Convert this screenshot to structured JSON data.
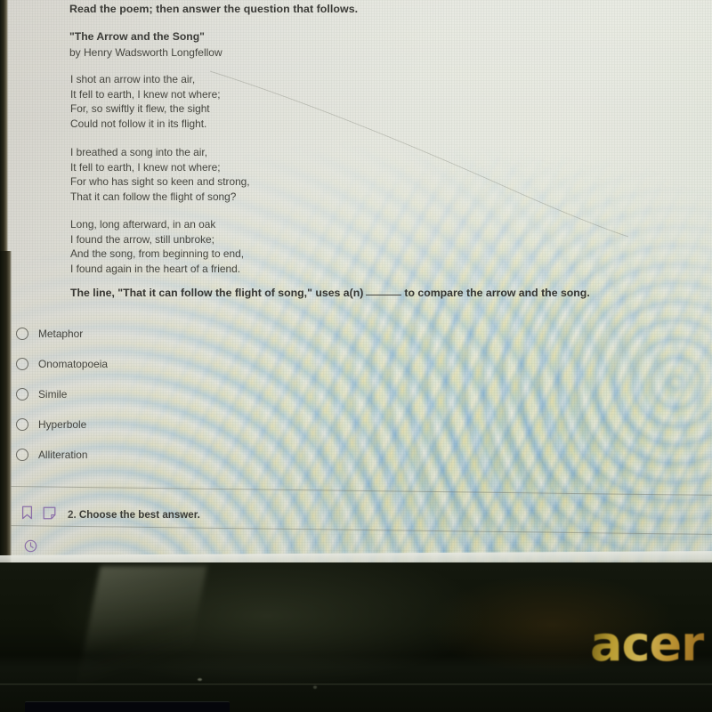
{
  "screen": {
    "prompt": "Read the poem; then answer the question that follows.",
    "poem": {
      "title": "\"The Arrow and the Song\"",
      "byline": "by Henry Wadsworth Longfellow",
      "stanzas": [
        "I shot an arrow into the air,\nIt fell to earth, I knew not where;\nFor, so swiftly it flew, the sight\nCould not follow it in its flight.",
        "I breathed a song into the air,\nIt fell to earth, I knew not where;\nFor who has sight so keen and strong,\nThat it can follow the flight of song?",
        "Long, long afterward, in an oak\nI found the arrow, still unbroke;\nAnd the song, from beginning to end,\nI found again in the heart of a friend."
      ]
    },
    "question": {
      "text_before_blank": "The line, \"That it can follow the flight of song,\" uses a(n)",
      "blank": "______",
      "text_after_blank": "to compare the arrow and the song."
    },
    "options": [
      {
        "label": "Metaphor",
        "selected": false
      },
      {
        "label": "Onomatopoeia",
        "selected": false
      },
      {
        "label": "Simile",
        "selected": false
      },
      {
        "label": "Hyperbole",
        "selected": false
      },
      {
        "label": "Alliteration",
        "selected": false
      }
    ],
    "footer": {
      "bookmark_icon": "bookmark-icon",
      "note_icon": "note-icon",
      "question_number": "2.",
      "instruction": "Choose the best answer.",
      "clock_icon": "clock-icon",
      "icon_color": "#8b6fa8"
    }
  },
  "device": {
    "brand_logo": "acer",
    "logo_color": "#d8b63a"
  },
  "colors": {
    "screen_background": "#e0e1d8",
    "text": "#45453e",
    "heading_text": "#3a3a36",
    "radio_outline": "#6c6c64",
    "divider": "#70746 8",
    "bezel": "#0f1309"
  }
}
